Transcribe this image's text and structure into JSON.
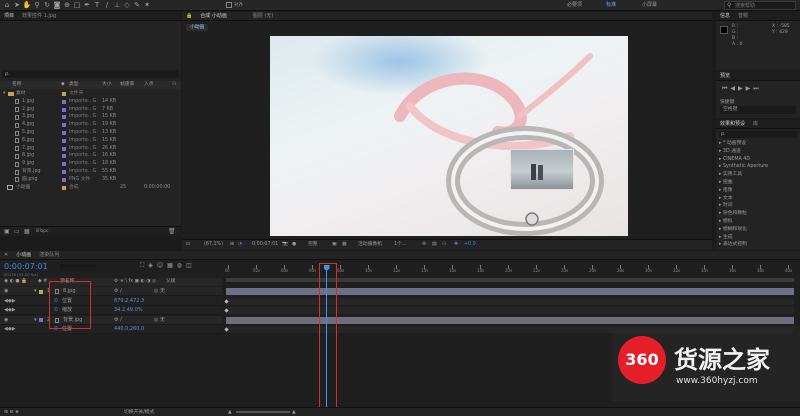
{
  "menubar": {
    "workspace_tabs": [
      "必要项",
      "标准",
      "小屏幕"
    ],
    "search_placeholder": "搜索帮助"
  },
  "project": {
    "tabs": [
      "项目",
      "效果控件 1.jpg"
    ],
    "search_placeholder": "ρ.",
    "columns": [
      "名称",
      "类型",
      "大小",
      "帧速率",
      "入点"
    ],
    "folder": {
      "name": "素材",
      "type": "文件夹"
    },
    "items": [
      {
        "name": "1.jpg",
        "type": "Importe...G",
        "size": "14 KB",
        "color": "#7c6fcf"
      },
      {
        "name": "2.jpg",
        "type": "Importe...G",
        "size": "7 KB",
        "color": "#7c6fcf"
      },
      {
        "name": "3.jpg",
        "type": "Importe...G",
        "size": "15 KB",
        "color": "#7c6fcf"
      },
      {
        "name": "4.jpg",
        "type": "Importe...G",
        "size": "19 KB",
        "color": "#7c6fcf"
      },
      {
        "name": "5.jpg",
        "type": "Importe...G",
        "size": "13 KB",
        "color": "#7c6fcf"
      },
      {
        "name": "6.jpg",
        "type": "Importe...G",
        "size": "15 KB",
        "color": "#7c6fcf"
      },
      {
        "name": "7.jpg",
        "type": "Importe...G",
        "size": "26 KB",
        "color": "#7c6fcf"
      },
      {
        "name": "8.jpg",
        "type": "Importe...G",
        "size": "16 KB",
        "color": "#7c6fcf"
      },
      {
        "name": "9.jpg",
        "type": "Importe...G",
        "size": "18 KB",
        "color": "#7c6fcf"
      },
      {
        "name": "背景.jpg",
        "type": "Importe...G",
        "size": "55 KB",
        "color": "#7c6fcf"
      },
      {
        "name": "圆.png",
        "type": "PNG 文件",
        "size": "35 KB",
        "color": "#7c6fcf"
      }
    ],
    "comp": {
      "name": "小动画",
      "type": "合成",
      "fps": "25",
      "in": "0:00:00:00"
    },
    "bpc": "8 bpc"
  },
  "composition": {
    "tabs": [
      "合成 小动画",
      "图层 (无)"
    ],
    "breadcrumb": "小动画",
    "zoom": "(67.1%)",
    "timecode": "0:00:07:01",
    "quality": "完整",
    "camera": "活动摄像机",
    "views": "1个...",
    "exposure": "+0.0"
  },
  "info": {
    "tabs": [
      "信息",
      "音频"
    ],
    "r": "R :",
    "g": "G :",
    "b": "B :",
    "a": "A : 0",
    "x": "X : -585",
    "y": "Y : 429"
  },
  "preview": {
    "title": "预览",
    "shortcut_label": "快捷键",
    "shortcut_value": "空格键"
  },
  "effects": {
    "title": "效果和预设",
    "alt_tab": "库",
    "search_placeholder": "ρ.",
    "items": [
      "* 动画预设",
      "3D 通道",
      "CINEMA 4D",
      "Synthetic Aperture",
      "实用工具",
      "扭曲",
      "抠像",
      "文本",
      "时间",
      "杂色和颗粒",
      "模拟",
      "模糊和锐化",
      "生成",
      "表达式控制"
    ]
  },
  "timeline": {
    "tabs": [
      "小动画",
      "渲染队列"
    ],
    "timecode": "0:00:07:01",
    "timecode_sub": "00176 (25.00 fps)",
    "columns": [
      "源名称",
      "父级"
    ],
    "layers": [
      {
        "index": "1",
        "name": "8.jpg",
        "parent": "无",
        "indent": 0
      },
      {
        "index": "",
        "name": "位置",
        "value": "879.2,472.3",
        "indent": 1
      },
      {
        "index": "",
        "name": "缩放",
        "value": "34.2,49.0%",
        "indent": 1
      },
      {
        "index": "2",
        "name": "背景.jpg",
        "parent": "无",
        "indent": 0
      },
      {
        "index": "",
        "name": "位置",
        "value": "440.0,260.0",
        "indent": 1
      }
    ],
    "ruler": [
      "0s",
      "02s",
      "04s",
      "06s",
      "08s",
      "10s",
      "12s",
      "14s",
      "16s",
      "18s",
      "20s",
      "22s",
      "24s",
      "26s",
      "28s",
      "30s",
      "32s",
      "34s",
      "36s",
      "38s",
      "40s"
    ],
    "playhead_seconds": 7.04,
    "duration_seconds": 40,
    "footer": "切换开关/模式"
  },
  "watermark": {
    "logo_number": "360",
    "brand": "货源之家",
    "url": "www.360hyzj.com"
  },
  "colors": {
    "accent": "#2d8ceb",
    "layer_bar": "#6e6e86",
    "bg_layer_bar": "#6e6e7e",
    "red": "#d03030"
  }
}
